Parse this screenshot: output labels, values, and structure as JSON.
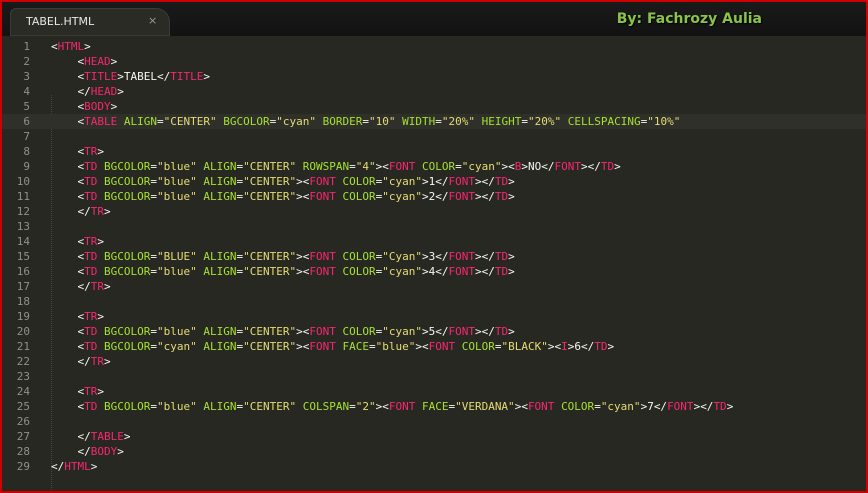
{
  "tab": {
    "title": "TABEL.HTML",
    "close_icon": "×"
  },
  "author": "By: Fachrozy Aulia",
  "colors": {
    "background": "#272822",
    "tag": "#f92672",
    "attribute": "#a6e22e",
    "string": "#e6db74",
    "text": "#f8f8f2",
    "line_number": "#8f908a",
    "author": "#8bc34a",
    "border": "#d10000"
  },
  "current_line": 6,
  "lines": [
    {
      "num": "1",
      "tokens": [
        [
          "p",
          "<"
        ],
        [
          "t",
          "HTML"
        ],
        [
          "p",
          ">"
        ]
      ]
    },
    {
      "num": "2",
      "tokens": [
        [
          "p",
          "    <"
        ],
        [
          "t",
          "HEAD"
        ],
        [
          "p",
          ">"
        ]
      ]
    },
    {
      "num": "3",
      "tokens": [
        [
          "p",
          "    <"
        ],
        [
          "t",
          "TITLE"
        ],
        [
          "p",
          ">"
        ],
        [
          "x",
          "TABEL"
        ],
        [
          "p",
          "</"
        ],
        [
          "t",
          "TITLE"
        ],
        [
          "p",
          ">"
        ]
      ]
    },
    {
      "num": "4",
      "tokens": [
        [
          "p",
          "    </"
        ],
        [
          "t",
          "HEAD"
        ],
        [
          "p",
          ">"
        ]
      ]
    },
    {
      "num": "5",
      "tokens": [
        [
          "p",
          "    <"
        ],
        [
          "t",
          "BODY"
        ],
        [
          "p",
          ">"
        ]
      ]
    },
    {
      "num": "6",
      "tokens": [
        [
          "p",
          "    <"
        ],
        [
          "t",
          "TABLE"
        ],
        [
          "p",
          " "
        ],
        [
          "a",
          "ALIGN"
        ],
        [
          "p",
          "="
        ],
        [
          "s",
          "\"CENTER\""
        ],
        [
          "p",
          " "
        ],
        [
          "a",
          "BGCOLOR"
        ],
        [
          "p",
          "="
        ],
        [
          "s",
          "\"cyan\""
        ],
        [
          "p",
          " "
        ],
        [
          "a",
          "BORDER"
        ],
        [
          "p",
          "="
        ],
        [
          "s",
          "\"10\""
        ],
        [
          "p",
          " "
        ],
        [
          "a",
          "WIDTH"
        ],
        [
          "p",
          "="
        ],
        [
          "s",
          "\"20%\""
        ],
        [
          "p",
          " "
        ],
        [
          "a",
          "HEIGHT"
        ],
        [
          "p",
          "="
        ],
        [
          "s",
          "\"20%\""
        ],
        [
          "p",
          " "
        ],
        [
          "a",
          "CELLSPACING"
        ],
        [
          "p",
          "="
        ],
        [
          "s",
          "\"10%\""
        ]
      ]
    },
    {
      "num": "7",
      "tokens": []
    },
    {
      "num": "8",
      "tokens": [
        [
          "p",
          "    <"
        ],
        [
          "t",
          "TR"
        ],
        [
          "p",
          ">"
        ]
      ]
    },
    {
      "num": "9",
      "tokens": [
        [
          "p",
          "    <"
        ],
        [
          "t",
          "TD"
        ],
        [
          "p",
          " "
        ],
        [
          "a",
          "BGCOLOR"
        ],
        [
          "p",
          "="
        ],
        [
          "s",
          "\"blue\""
        ],
        [
          "p",
          " "
        ],
        [
          "a",
          "ALIGN"
        ],
        [
          "p",
          "="
        ],
        [
          "s",
          "\"CENTER\""
        ],
        [
          "p",
          " "
        ],
        [
          "a",
          "ROWSPAN"
        ],
        [
          "p",
          "="
        ],
        [
          "s",
          "\"4\""
        ],
        [
          "p",
          ">"
        ],
        [
          "p",
          "<"
        ],
        [
          "t",
          "FONT"
        ],
        [
          "p",
          " "
        ],
        [
          "a",
          "COLOR"
        ],
        [
          "p",
          "="
        ],
        [
          "s",
          "\"cyan\""
        ],
        [
          "p",
          ">"
        ],
        [
          "p",
          "<"
        ],
        [
          "t",
          "B"
        ],
        [
          "p",
          ">"
        ],
        [
          "x",
          "NO"
        ],
        [
          "p",
          "</"
        ],
        [
          "t",
          "FONT"
        ],
        [
          "p",
          ">"
        ],
        [
          "p",
          "</"
        ],
        [
          "t",
          "TD"
        ],
        [
          "p",
          ">"
        ]
      ]
    },
    {
      "num": "10",
      "tokens": [
        [
          "p",
          "    <"
        ],
        [
          "t",
          "TD"
        ],
        [
          "p",
          " "
        ],
        [
          "a",
          "BGCOLOR"
        ],
        [
          "p",
          "="
        ],
        [
          "s",
          "\"blue\""
        ],
        [
          "p",
          " "
        ],
        [
          "a",
          "ALIGN"
        ],
        [
          "p",
          "="
        ],
        [
          "s",
          "\"CENTER\""
        ],
        [
          "p",
          ">"
        ],
        [
          "p",
          "<"
        ],
        [
          "t",
          "FONT"
        ],
        [
          "p",
          " "
        ],
        [
          "a",
          "COLOR"
        ],
        [
          "p",
          "="
        ],
        [
          "s",
          "\"cyan\""
        ],
        [
          "p",
          ">"
        ],
        [
          "x",
          "1"
        ],
        [
          "p",
          "</"
        ],
        [
          "t",
          "FONT"
        ],
        [
          "p",
          ">"
        ],
        [
          "p",
          "</"
        ],
        [
          "t",
          "TD"
        ],
        [
          "p",
          ">"
        ]
      ]
    },
    {
      "num": "11",
      "tokens": [
        [
          "p",
          "    <"
        ],
        [
          "t",
          "TD"
        ],
        [
          "p",
          " "
        ],
        [
          "a",
          "BGCOLOR"
        ],
        [
          "p",
          "="
        ],
        [
          "s",
          "\"blue\""
        ],
        [
          "p",
          " "
        ],
        [
          "a",
          "ALIGN"
        ],
        [
          "p",
          "="
        ],
        [
          "s",
          "\"CENTER\""
        ],
        [
          "p",
          ">"
        ],
        [
          "p",
          "<"
        ],
        [
          "t",
          "FONT"
        ],
        [
          "p",
          " "
        ],
        [
          "a",
          "COLOR"
        ],
        [
          "p",
          "="
        ],
        [
          "s",
          "\"cyan\""
        ],
        [
          "p",
          ">"
        ],
        [
          "x",
          "2"
        ],
        [
          "p",
          "</"
        ],
        [
          "t",
          "FONT"
        ],
        [
          "p",
          ">"
        ],
        [
          "p",
          "</"
        ],
        [
          "t",
          "TD"
        ],
        [
          "p",
          ">"
        ]
      ]
    },
    {
      "num": "12",
      "tokens": [
        [
          "p",
          "    </"
        ],
        [
          "t",
          "TR"
        ],
        [
          "p",
          ">"
        ]
      ]
    },
    {
      "num": "13",
      "tokens": []
    },
    {
      "num": "14",
      "tokens": [
        [
          "p",
          "    <"
        ],
        [
          "t",
          "TR"
        ],
        [
          "p",
          ">"
        ]
      ]
    },
    {
      "num": "15",
      "tokens": [
        [
          "p",
          "    <"
        ],
        [
          "t",
          "TD"
        ],
        [
          "p",
          " "
        ],
        [
          "a",
          "BGCOLOR"
        ],
        [
          "p",
          "="
        ],
        [
          "s",
          "\"BLUE\""
        ],
        [
          "p",
          " "
        ],
        [
          "a",
          "ALIGN"
        ],
        [
          "p",
          "="
        ],
        [
          "s",
          "\"CENTER\""
        ],
        [
          "p",
          ">"
        ],
        [
          "p",
          "<"
        ],
        [
          "t",
          "FONT"
        ],
        [
          "p",
          " "
        ],
        [
          "a",
          "COLOR"
        ],
        [
          "p",
          "="
        ],
        [
          "s",
          "\"Cyan\""
        ],
        [
          "p",
          ">"
        ],
        [
          "x",
          "3"
        ],
        [
          "p",
          "</"
        ],
        [
          "t",
          "FONT"
        ],
        [
          "p",
          ">"
        ],
        [
          "p",
          "</"
        ],
        [
          "t",
          "TD"
        ],
        [
          "p",
          ">"
        ]
      ]
    },
    {
      "num": "16",
      "tokens": [
        [
          "p",
          "    <"
        ],
        [
          "t",
          "TD"
        ],
        [
          "p",
          " "
        ],
        [
          "a",
          "BGCOLOR"
        ],
        [
          "p",
          "="
        ],
        [
          "s",
          "\"blue\""
        ],
        [
          "p",
          " "
        ],
        [
          "a",
          "ALIGN"
        ],
        [
          "p",
          "="
        ],
        [
          "s",
          "\"CENTER\""
        ],
        [
          "p",
          ">"
        ],
        [
          "p",
          "<"
        ],
        [
          "t",
          "FONT"
        ],
        [
          "p",
          " "
        ],
        [
          "a",
          "COLOR"
        ],
        [
          "p",
          "="
        ],
        [
          "s",
          "\"cyan\""
        ],
        [
          "p",
          ">"
        ],
        [
          "x",
          "4"
        ],
        [
          "p",
          "</"
        ],
        [
          "t",
          "FONT"
        ],
        [
          "p",
          ">"
        ],
        [
          "p",
          "</"
        ],
        [
          "t",
          "TD"
        ],
        [
          "p",
          ">"
        ]
      ]
    },
    {
      "num": "17",
      "tokens": [
        [
          "p",
          "    </"
        ],
        [
          "t",
          "TR"
        ],
        [
          "p",
          ">"
        ]
      ]
    },
    {
      "num": "18",
      "tokens": []
    },
    {
      "num": "19",
      "tokens": [
        [
          "p",
          "    <"
        ],
        [
          "t",
          "TR"
        ],
        [
          "p",
          ">"
        ]
      ]
    },
    {
      "num": "20",
      "tokens": [
        [
          "p",
          "    <"
        ],
        [
          "t",
          "TD"
        ],
        [
          "p",
          " "
        ],
        [
          "a",
          "BGCOLOR"
        ],
        [
          "p",
          "="
        ],
        [
          "s",
          "\"blue\""
        ],
        [
          "p",
          " "
        ],
        [
          "a",
          "ALIGN"
        ],
        [
          "p",
          "="
        ],
        [
          "s",
          "\"CENTER\""
        ],
        [
          "p",
          ">"
        ],
        [
          "p",
          "<"
        ],
        [
          "t",
          "FONT"
        ],
        [
          "p",
          " "
        ],
        [
          "a",
          "COLOR"
        ],
        [
          "p",
          "="
        ],
        [
          "s",
          "\"cyan\""
        ],
        [
          "p",
          ">"
        ],
        [
          "x",
          "5"
        ],
        [
          "p",
          "</"
        ],
        [
          "t",
          "FONT"
        ],
        [
          "p",
          ">"
        ],
        [
          "p",
          "</"
        ],
        [
          "t",
          "TD"
        ],
        [
          "p",
          ">"
        ]
      ]
    },
    {
      "num": "21",
      "tokens": [
        [
          "p",
          "    <"
        ],
        [
          "t",
          "TD"
        ],
        [
          "p",
          " "
        ],
        [
          "a",
          "BGCOLOR"
        ],
        [
          "p",
          "="
        ],
        [
          "s",
          "\"cyan\""
        ],
        [
          "p",
          " "
        ],
        [
          "a",
          "ALIGN"
        ],
        [
          "p",
          "="
        ],
        [
          "s",
          "\"CENTER\""
        ],
        [
          "p",
          ">"
        ],
        [
          "p",
          "<"
        ],
        [
          "t",
          "FONT"
        ],
        [
          "p",
          " "
        ],
        [
          "a",
          "FACE"
        ],
        [
          "p",
          "="
        ],
        [
          "s",
          "\"blue\""
        ],
        [
          "p",
          ">"
        ],
        [
          "p",
          "<"
        ],
        [
          "t",
          "FONT"
        ],
        [
          "p",
          " "
        ],
        [
          "a",
          "COLOR"
        ],
        [
          "p",
          "="
        ],
        [
          "s",
          "\"BLACK\""
        ],
        [
          "p",
          ">"
        ],
        [
          "p",
          "<"
        ],
        [
          "t",
          "I"
        ],
        [
          "p",
          ">"
        ],
        [
          "x",
          "6"
        ],
        [
          "p",
          "</"
        ],
        [
          "t",
          "TD"
        ],
        [
          "p",
          ">"
        ]
      ]
    },
    {
      "num": "22",
      "tokens": [
        [
          "p",
          "    </"
        ],
        [
          "t",
          "TR"
        ],
        [
          "p",
          ">"
        ]
      ]
    },
    {
      "num": "23",
      "tokens": []
    },
    {
      "num": "24",
      "tokens": [
        [
          "p",
          "    <"
        ],
        [
          "t",
          "TR"
        ],
        [
          "p",
          ">"
        ]
      ]
    },
    {
      "num": "25",
      "tokens": [
        [
          "p",
          "    <"
        ],
        [
          "t",
          "TD"
        ],
        [
          "p",
          " "
        ],
        [
          "a",
          "BGCOLOR"
        ],
        [
          "p",
          "="
        ],
        [
          "s",
          "\"blue\""
        ],
        [
          "p",
          " "
        ],
        [
          "a",
          "ALIGN"
        ],
        [
          "p",
          "="
        ],
        [
          "s",
          "\"CENTER\""
        ],
        [
          "p",
          " "
        ],
        [
          "a",
          "COLSPAN"
        ],
        [
          "p",
          "="
        ],
        [
          "s",
          "\"2\""
        ],
        [
          "p",
          ">"
        ],
        [
          "p",
          "<"
        ],
        [
          "t",
          "FONT"
        ],
        [
          "p",
          " "
        ],
        [
          "a",
          "FACE"
        ],
        [
          "p",
          "="
        ],
        [
          "s",
          "\"VERDANA\""
        ],
        [
          "p",
          ">"
        ],
        [
          "p",
          "<"
        ],
        [
          "t",
          "FONT"
        ],
        [
          "p",
          " "
        ],
        [
          "a",
          "COLOR"
        ],
        [
          "p",
          "="
        ],
        [
          "s",
          "\"cyan\""
        ],
        [
          "p",
          ">"
        ],
        [
          "x",
          "7"
        ],
        [
          "p",
          "</"
        ],
        [
          "t",
          "FONT"
        ],
        [
          "p",
          ">"
        ],
        [
          "p",
          "</"
        ],
        [
          "t",
          "TD"
        ],
        [
          "p",
          ">"
        ]
      ]
    },
    {
      "num": "26",
      "tokens": []
    },
    {
      "num": "27",
      "tokens": [
        [
          "p",
          "    </"
        ],
        [
          "t",
          "TABLE"
        ],
        [
          "p",
          ">"
        ]
      ]
    },
    {
      "num": "28",
      "tokens": [
        [
          "p",
          "    </"
        ],
        [
          "t",
          "BODY"
        ],
        [
          "p",
          ">"
        ]
      ]
    },
    {
      "num": "29",
      "tokens": [
        [
          "p",
          "</"
        ],
        [
          "t",
          "HTML"
        ],
        [
          "p",
          ">"
        ]
      ]
    }
  ]
}
